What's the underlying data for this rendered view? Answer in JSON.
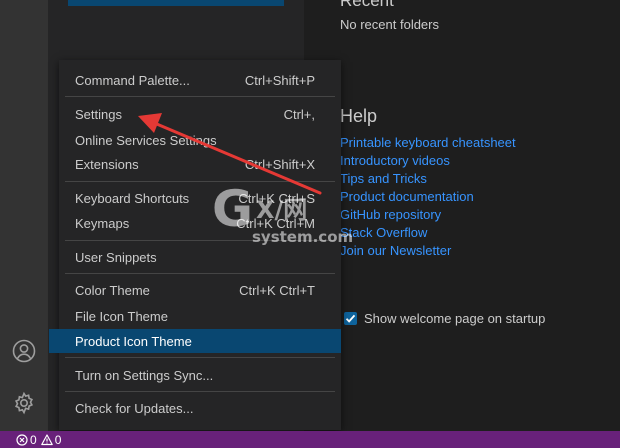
{
  "welcome": {
    "recent_title": "Recent",
    "recent_empty": "No recent folders",
    "help_title": "Help",
    "help_links": [
      "Printable keyboard cheatsheet",
      "Introductory videos",
      "Tips and Tricks",
      "Product documentation",
      "GitHub repository",
      "Stack Overflow",
      "Join our Newsletter"
    ],
    "show_on_startup_label": "Show welcome page on startup",
    "show_on_startup_checked": true
  },
  "menu": {
    "items": [
      {
        "label": "Command Palette...",
        "shortcut": "Ctrl+Shift+P"
      },
      {
        "label": "Settings",
        "shortcut": "Ctrl+,"
      },
      {
        "label": "Online Services Settings",
        "shortcut": ""
      },
      {
        "label": "Extensions",
        "shortcut": "Ctrl+Shift+X"
      },
      {
        "label": "Keyboard Shortcuts",
        "shortcut": "Ctrl+K Ctrl+S"
      },
      {
        "label": "Keymaps",
        "shortcut": "Ctrl+K Ctrl+M"
      },
      {
        "label": "User Snippets",
        "shortcut": ""
      },
      {
        "label": "Color Theme",
        "shortcut": "Ctrl+K Ctrl+T"
      },
      {
        "label": "File Icon Theme",
        "shortcut": ""
      },
      {
        "label": "Product Icon Theme",
        "shortcut": ""
      },
      {
        "label": "Turn on Settings Sync...",
        "shortcut": ""
      },
      {
        "label": "Check for Updates...",
        "shortcut": ""
      }
    ],
    "active_item": "Product Icon Theme"
  },
  "activity_bar": {
    "icons": [
      "account-icon",
      "manage-gear-icon"
    ]
  },
  "status_bar": {
    "errors": "0",
    "warnings": "0",
    "background_color": "#68217a"
  },
  "watermark": {
    "letter": "G",
    "mark": "X/网",
    "domain": "system.com"
  },
  "annotation": {
    "arrow_color": "#e53935"
  }
}
